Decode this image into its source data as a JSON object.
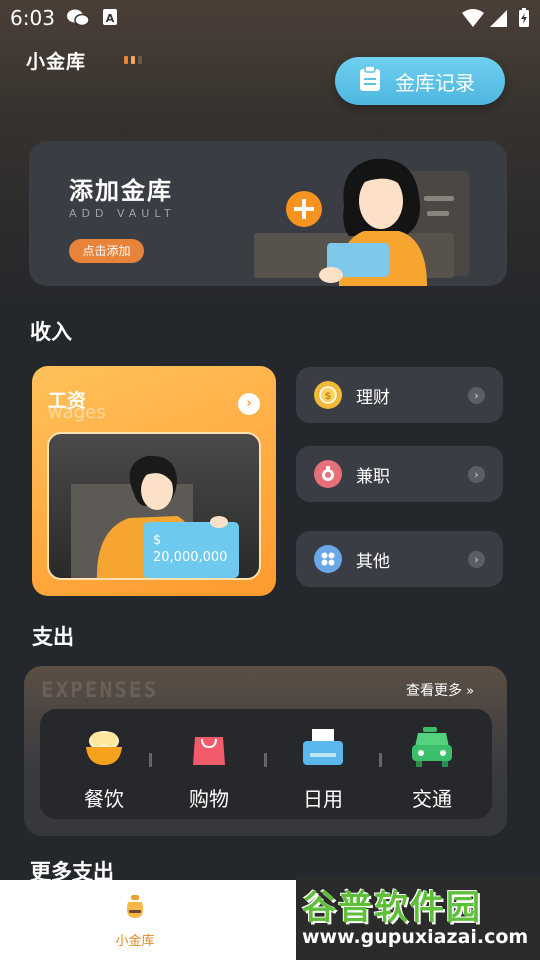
{
  "status_bar": {
    "time": "6:03"
  },
  "app": {
    "title": "小金库"
  },
  "header": {
    "records_label": "金库记录"
  },
  "add_vault": {
    "title": "添加金库",
    "subtitle": "ADD VAULT",
    "button_label": "点击添加"
  },
  "income": {
    "section_title": "收入",
    "wages": {
      "title": "工资",
      "subtitle": "wages",
      "amount": "$ 20,000,000"
    },
    "items": [
      {
        "label": "理财",
        "icon": "coin-icon",
        "color": "#f0b93a"
      },
      {
        "label": "兼职",
        "icon": "medal-icon",
        "color": "#e8707a"
      },
      {
        "label": "其他",
        "icon": "grid-icon",
        "color": "#6aa8e8"
      }
    ]
  },
  "expenses": {
    "section_title": "支出",
    "banner_word": "EXPENSES",
    "more_label": "查看更多",
    "items": [
      {
        "label": "餐饮",
        "icon": "food-bowl-icon"
      },
      {
        "label": "购物",
        "icon": "shopping-bag-icon"
      },
      {
        "label": "日用",
        "icon": "printer-icon"
      },
      {
        "label": "交通",
        "icon": "car-icon"
      }
    ]
  },
  "more_expenses": {
    "section_title": "更多支出"
  },
  "bottom_nav": {
    "home_label": "小金库"
  },
  "watermark": {
    "name": "谷普软件园",
    "url": "www.gupuxiazai.com"
  },
  "colors": {
    "accent_orange": "#ff9a2e",
    "accent_blue": "#4eb6e0",
    "background": "#24272b"
  }
}
